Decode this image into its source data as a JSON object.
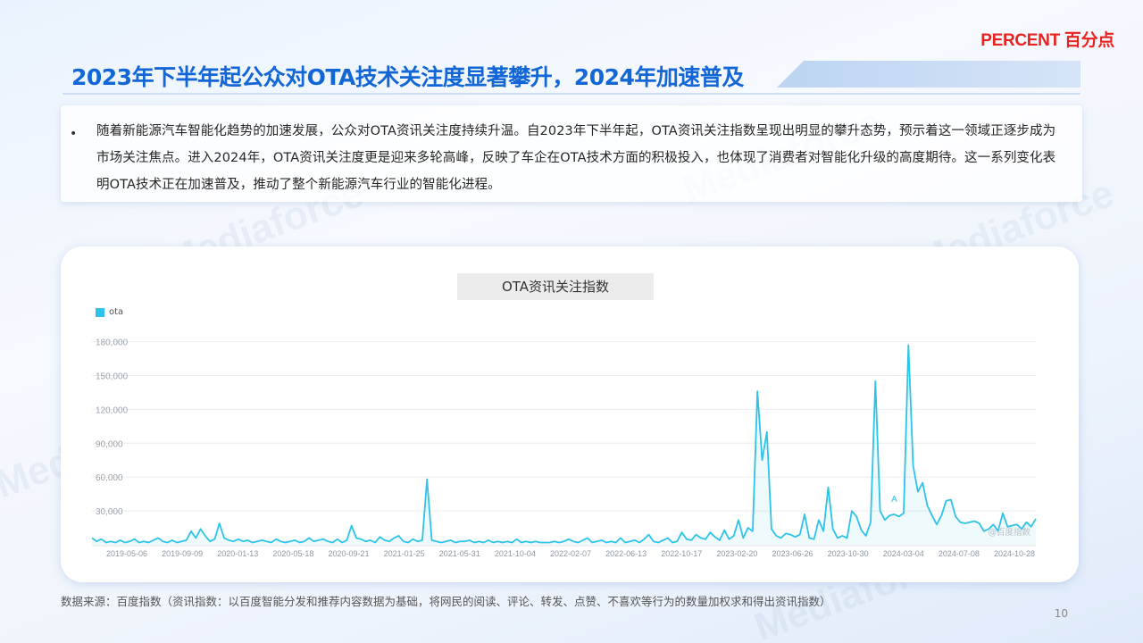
{
  "brand": {
    "logo_text": "PERCENT 百分点",
    "accent": "#e8231f"
  },
  "page": {
    "title": "2023年下半年起公众对OTA技术关注度显著攀升，2024年加速普及",
    "title_color": "#1366d6",
    "page_number": "10"
  },
  "summary": {
    "bullet": "•",
    "text": "随着新能源汽车智能化趋势的加速发展，公众对OTA资讯关注度持续升温。自2023年下半年起，OTA资讯关注指数呈现出明显的攀升态势，预示着这一领域正逐步成为市场关注焦点。进入2024年，OTA资讯关注度更是迎来多轮高峰，反映了车企在OTA技术方面的积极投入，也体现了消费者对智能化升级的高度期待。这一系列变化表明OTA技术正在加速普及，推动了整个新能源汽车行业的智能化进程。"
  },
  "watermark": "Mediaforce",
  "chart_data": {
    "type": "area",
    "title": "OTA资讯关注指数",
    "legend_position": "top-left",
    "grid": true,
    "series": [
      {
        "name": "ota",
        "color": "#2ec3e8",
        "values": [
          6000,
          3000,
          5000,
          2000,
          3000,
          2000,
          4000,
          2000,
          3000,
          5000,
          2000,
          3000,
          2000,
          4000,
          6000,
          3000,
          2000,
          4000,
          2000,
          3000,
          4000,
          12000,
          6000,
          14000,
          8000,
          3000,
          5000,
          19000,
          6000,
          4000,
          3000,
          5000,
          3000,
          4000,
          2000,
          3000,
          4000,
          3000,
          2000,
          5000,
          3000,
          2000,
          3000,
          4000,
          2000,
          3000,
          6000,
          3000,
          4000,
          5000,
          3000,
          2000,
          5000,
          2000,
          4000,
          17000,
          6000,
          5000,
          3000,
          4000,
          2000,
          7000,
          4000,
          3000,
          6000,
          8000,
          3000,
          2000,
          5000,
          3000,
          4000,
          58000,
          4000,
          3000,
          2000,
          3000,
          4000,
          2000,
          3000,
          3000,
          4000,
          2000,
          3000,
          2000,
          4000,
          2000,
          3000,
          2000,
          3000,
          2000,
          5000,
          2000,
          3000,
          2000,
          3000,
          2000,
          2000,
          2000,
          3000,
          2000,
          3000,
          5000,
          3000,
          2000,
          4000,
          6000,
          2000,
          3000,
          4000,
          2000,
          3000,
          2000,
          6000,
          2000,
          3000,
          4000,
          2000,
          5000,
          9000,
          3000,
          2000,
          4000,
          6000,
          2000,
          3000,
          11000,
          5000,
          4000,
          9000,
          6000,
          5000,
          11000,
          7000,
          4000,
          13000,
          5000,
          8000,
          22000,
          6000,
          15000,
          12000,
          136000,
          75000,
          100000,
          14000,
          8000,
          6000,
          10000,
          9000,
          7000,
          9000,
          27000,
          6000,
          5000,
          22000,
          12000,
          51000,
          14000,
          6000,
          8000,
          6000,
          30000,
          25000,
          13000,
          8000,
          20000,
          145000,
          30000,
          22000,
          26000,
          27000,
          25000,
          28000,
          177000,
          70000,
          47000,
          55000,
          35000,
          26000,
          18000,
          26000,
          39000,
          40000,
          25000,
          20000,
          19000,
          20000,
          21000,
          19000,
          12000,
          14000,
          18000,
          12000,
          28000,
          16000,
          17000,
          18000,
          14000,
          20000,
          16000,
          23000
        ]
      }
    ],
    "x_ticks": [
      "2019-05-06",
      "2019-09-09",
      "2020-01-13",
      "2020-05-18",
      "2020-09-21",
      "2021-01-25",
      "2021-05-31",
      "2021-10-04",
      "2022-02-07",
      "2022-06-13",
      "2022-10-17",
      "2023-02-20",
      "2023-06-26",
      "2023-10-30",
      "2024-03-04",
      "2024-07-08",
      "2024-10-28"
    ],
    "y_ticks": [
      "180,000",
      "150,000",
      "120,000",
      "90,000",
      "60,000",
      "30,000"
    ],
    "ylim": [
      0,
      186000
    ],
    "annotations": [
      {
        "label": "A",
        "index": 170
      }
    ],
    "credit": "@百度指数"
  },
  "source_note": "数据来源：百度指数（资讯指数：以百度智能分发和推荐内容数据为基础，将网民的阅读、评论、转发、点赞、不喜欢等行为的数量加权求和得出资讯指数）"
}
